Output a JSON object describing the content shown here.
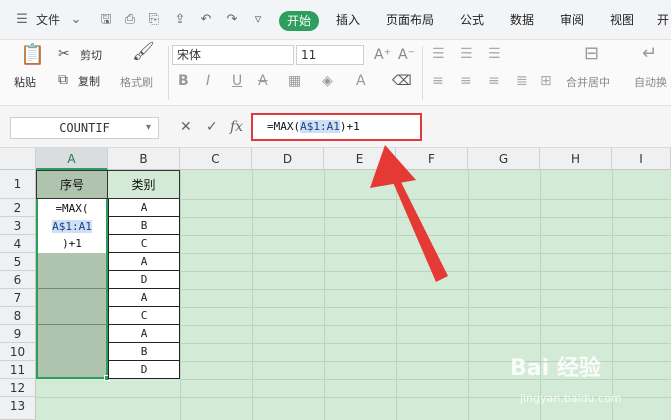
{
  "menubar": {
    "file_label": "文件",
    "tabs": [
      "插入",
      "页面布局",
      "公式",
      "数据",
      "审阅",
      "视图",
      "开"
    ],
    "active_tab": "开始"
  },
  "ribbon": {
    "cut": "剪切",
    "paste": "粘贴",
    "copy": "复制",
    "format_painter": "格式刷",
    "font_name": "宋体",
    "font_size": "11",
    "bold": "B",
    "italic": "I",
    "underline": "U",
    "merge_center": "合并居中",
    "auto_wrap": "自动换"
  },
  "formulabar": {
    "name_box": "COUNTIF",
    "fx": "fx",
    "formula_prefix": "=MAX(",
    "formula_ref": "A$1:A1",
    "formula_suffix": ")+1"
  },
  "columns": [
    "A",
    "B",
    "C",
    "D",
    "E",
    "F",
    "G",
    "H",
    "I"
  ],
  "rows": [
    "1",
    "2",
    "3",
    "4",
    "5",
    "6",
    "7",
    "8",
    "9",
    "10",
    "11",
    "12",
    "13"
  ],
  "cells": {
    "a1": "序号",
    "b1": "类别",
    "a2_line1": "=MAX(",
    "a2_line2": "A$1:A1",
    "a2_line3": ")+1",
    "b_values": [
      "A",
      "B",
      "C",
      "A",
      "D",
      "A",
      "C",
      "A",
      "B",
      "D"
    ]
  },
  "watermark": {
    "brand": "Bai 经验",
    "url": "jingyan.baidu.com"
  },
  "colors": {
    "accent": "#2e9e5e",
    "highlight_box": "#e03a3a",
    "grid_bg": "#d3ead6"
  }
}
